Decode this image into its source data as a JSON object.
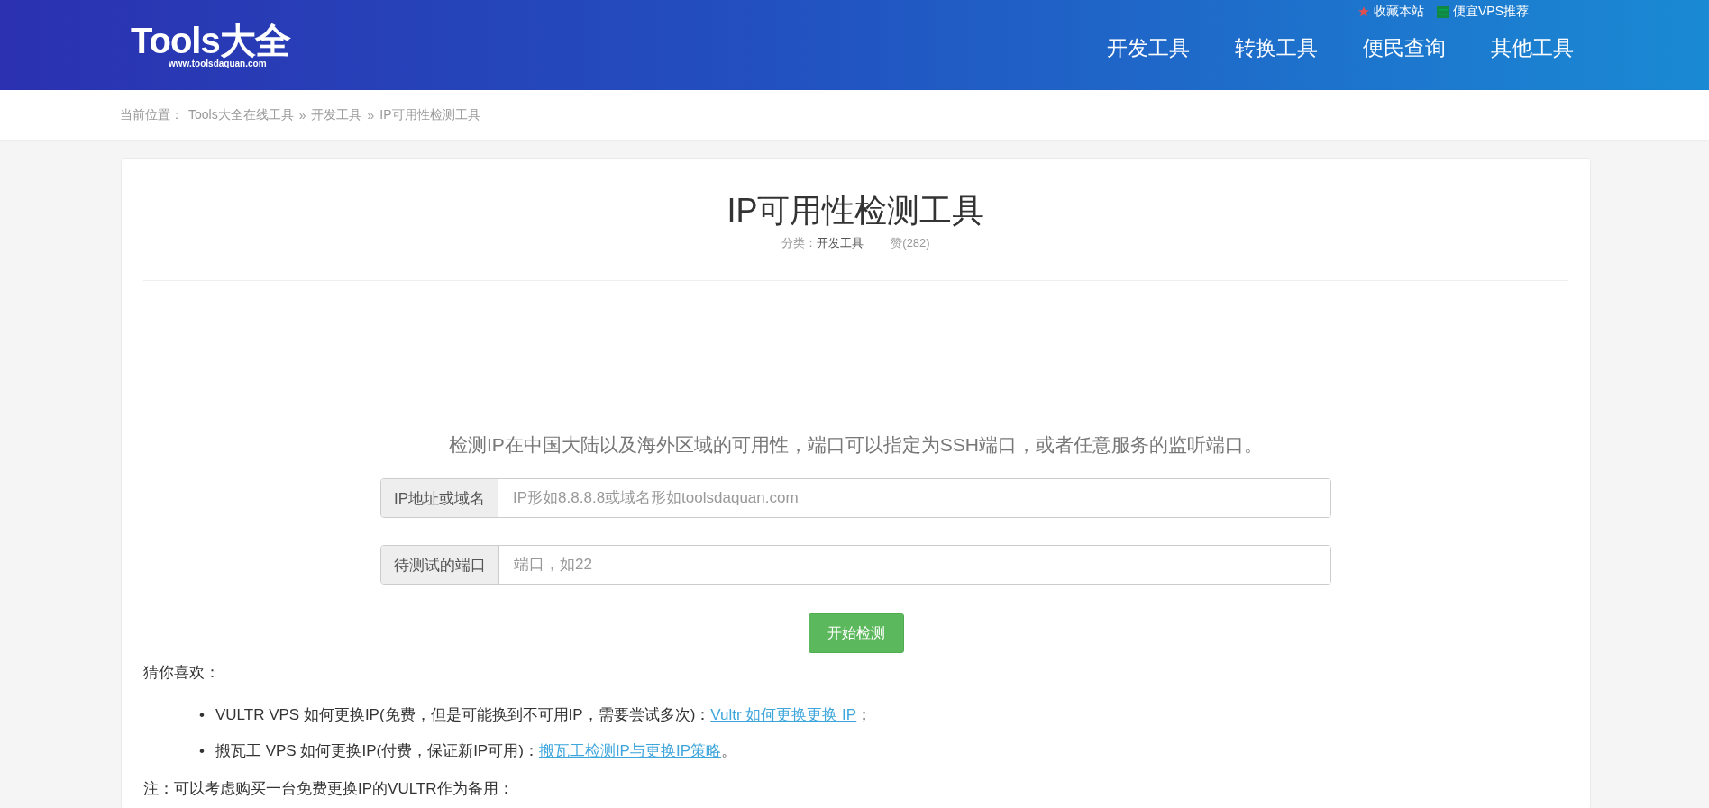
{
  "header": {
    "logo": {
      "name": "Tools大全",
      "url": "www.toolsdaquan.com"
    },
    "top_links": [
      {
        "kind": "star",
        "label": "收藏本站"
      },
      {
        "kind": "server",
        "label": "便宜VPS推荐"
      }
    ],
    "nav": [
      {
        "label": "开发工具"
      },
      {
        "label": "转换工具"
      },
      {
        "label": "便民查询"
      },
      {
        "label": "其他工具"
      }
    ]
  },
  "breadcrumb": {
    "prefix": "当前位置：",
    "items": [
      "Tools大全在线工具",
      "开发工具",
      "IP可用性检测工具"
    ],
    "separator": "»"
  },
  "tool": {
    "title": "IP可用性检测工具",
    "category_label": "分类：",
    "category": "开发工具",
    "likes": "赞(282)",
    "description": "检测IP在中国大陆以及海外区域的可用性，端口可以指定为SSH端口，或者任意服务的监听端口。",
    "fields": [
      {
        "label": "IP地址或域名",
        "placeholder": "IP形如8.8.8.8或域名形如toolsdaquan.com"
      },
      {
        "label": "待测试的端口",
        "placeholder": "端口，如22"
      }
    ],
    "button": "开始检测"
  },
  "recommend": {
    "heading": "猜你喜欢：",
    "marker": "•",
    "items": [
      {
        "text": "VULTR VPS 如何更换IP(免费，但是可能换到不可用IP，需要尝试多次)：",
        "link": "Vultr 如何更换更换 IP",
        "suffix": "；"
      },
      {
        "text": "搬瓦工 VPS 如何更换IP(付费，保证新IP可用)：",
        "link": "搬瓦工检测IP与更换IP策略",
        "suffix": "。"
      }
    ],
    "note": "注：可以考虑购买一台免费更换IP的VULTR作为备用："
  }
}
